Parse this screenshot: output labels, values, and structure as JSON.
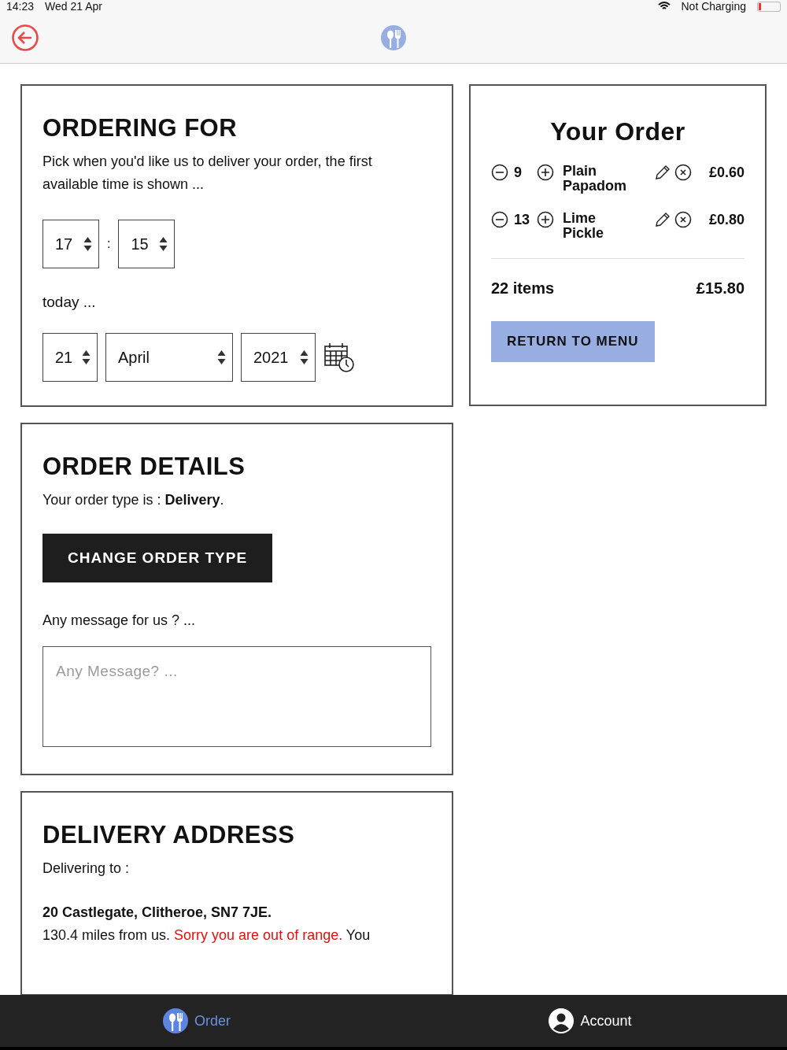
{
  "status_bar": {
    "time": "14:23",
    "date": "Wed 21 Apr",
    "charging": "Not Charging"
  },
  "ordering_for": {
    "title": "ORDERING FOR",
    "description": "Pick when you'd like us to deliver your order, the first available time is shown ...",
    "hour": "17",
    "minute": "15",
    "separator": ":",
    "day_label": "today ...",
    "day": "21",
    "month": "April",
    "year": "2021"
  },
  "order_details": {
    "title": "ORDER DETAILS",
    "order_type_text": "Your order type is : **Delivery**.",
    "change_button": "CHANGE ORDER TYPE",
    "message_label": "Any message for us ? ...",
    "message_placeholder": "Any Message? ..."
  },
  "delivery_address": {
    "title": "DELIVERY ADDRESS",
    "label": "Delivering to :",
    "address": "20 Castlegate, Clitheroe, SN7 7JE.",
    "note": [
      {
        "kind": "normal",
        "text": "130.4 miles from us. "
      },
      {
        "kind": "warning",
        "text": "Sorry you are out of range."
      },
      {
        "kind": "normal",
        "text": " You"
      }
    ]
  },
  "your_order": {
    "title": "Your Order",
    "items": [
      {
        "quantity": "9",
        "name": "Plain Papadom",
        "price": "£0.60"
      },
      {
        "quantity": "13",
        "name": "Lime Pickle",
        "price": "£0.80"
      }
    ],
    "total_items": "22 items",
    "total_price": "£15.80",
    "return_button": "RETURN TO MENU"
  },
  "tab_bar": [
    {
      "label": "Order",
      "kind": "order",
      "selected": true
    },
    {
      "label": "Account",
      "kind": "account",
      "selected": false
    }
  ]
}
